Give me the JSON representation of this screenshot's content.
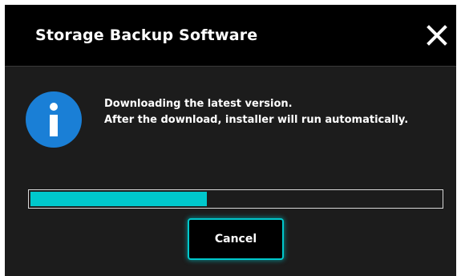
{
  "dialog": {
    "title": "Storage Backup Software",
    "close_icon": "close-icon",
    "info_icon": "info-icon",
    "message_lines": [
      "Downloading the latest version.",
      "After the download, installer will run automatically."
    ],
    "progress_fraction": 0.43,
    "cancel_label": "Cancel"
  },
  "colors": {
    "title_bar": "#000000",
    "body": "#1c1c1c",
    "accent": "#00c8cc",
    "info_icon": "#1a7fd6"
  }
}
